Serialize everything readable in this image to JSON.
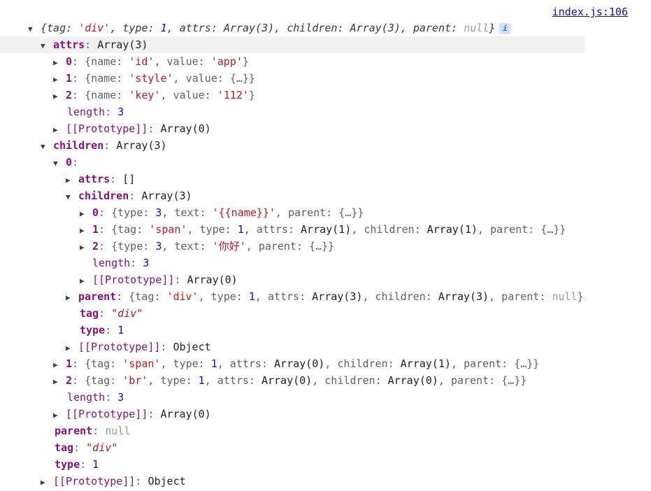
{
  "source_link": "index.js:106",
  "root_preview": {
    "open": "{",
    "tag_key": "tag",
    "tag_val": "'div'",
    "type_key": "type",
    "type_val": "1",
    "attrs_key": "attrs",
    "attrs_val": "Array(3)",
    "children_key": "children",
    "children_val": "Array(3)",
    "parent_key": "parent",
    "parent_val": "null",
    "close": "}",
    "info_icon": "i"
  },
  "tree": {
    "attrs_label": "attrs",
    "attrs_summary": "Array(3)",
    "attr_items": [
      {
        "idx": "0",
        "pre": "{name: ",
        "name": "'id'",
        "mid": ", value: ",
        "value": "'app'",
        "post": "}"
      },
      {
        "idx": "1",
        "pre": "{name: ",
        "name": "'style'",
        "mid": ", value: ",
        "value": "{…}",
        "post": "}"
      },
      {
        "idx": "2",
        "pre": "{name: ",
        "name": "'key'",
        "mid": ", value: ",
        "value": "'112'",
        "post": "}"
      }
    ],
    "length_label": "length",
    "length_3": "3",
    "proto_label": "[[Prototype]]",
    "proto_array0": "Array(0)",
    "proto_object": "Object",
    "children_label": "children",
    "children_summary": "Array(3)",
    "child0_label": "0",
    "child0_attrs_label": "attrs",
    "child0_attrs_val": "[]",
    "child0_children_label": "children",
    "child0_children_summary": "Array(3)",
    "grand": [
      {
        "idx": "0",
        "text": "{type: 3, text: '{{name}}', parent: {…}}"
      },
      {
        "idx": "1",
        "text": "{tag: 'span', type: 1, attrs: Array(1), children: Array(1), parent: {…}}"
      },
      {
        "idx": "2",
        "text": "{type: 3, text: '你好', parent: {…}}"
      }
    ],
    "child0_parent_label": "parent",
    "child0_parent_val": "{tag: 'div', type: 1, attrs: Array(3), children: Array(3), parent: null}",
    "tag_label": "tag",
    "tag_val": "\"div\"",
    "type_label": "type",
    "type_val": "1",
    "child1": {
      "idx": "1",
      "text": "{tag: 'span', type: 1, attrs: Array(0), children: Array(1), parent: {…}}"
    },
    "child2": {
      "idx": "2",
      "text": "{tag: 'br', type: 1, attrs: Array(0), children: Array(0), parent: {…}}"
    },
    "parent_label": "parent",
    "parent_val": "null"
  }
}
